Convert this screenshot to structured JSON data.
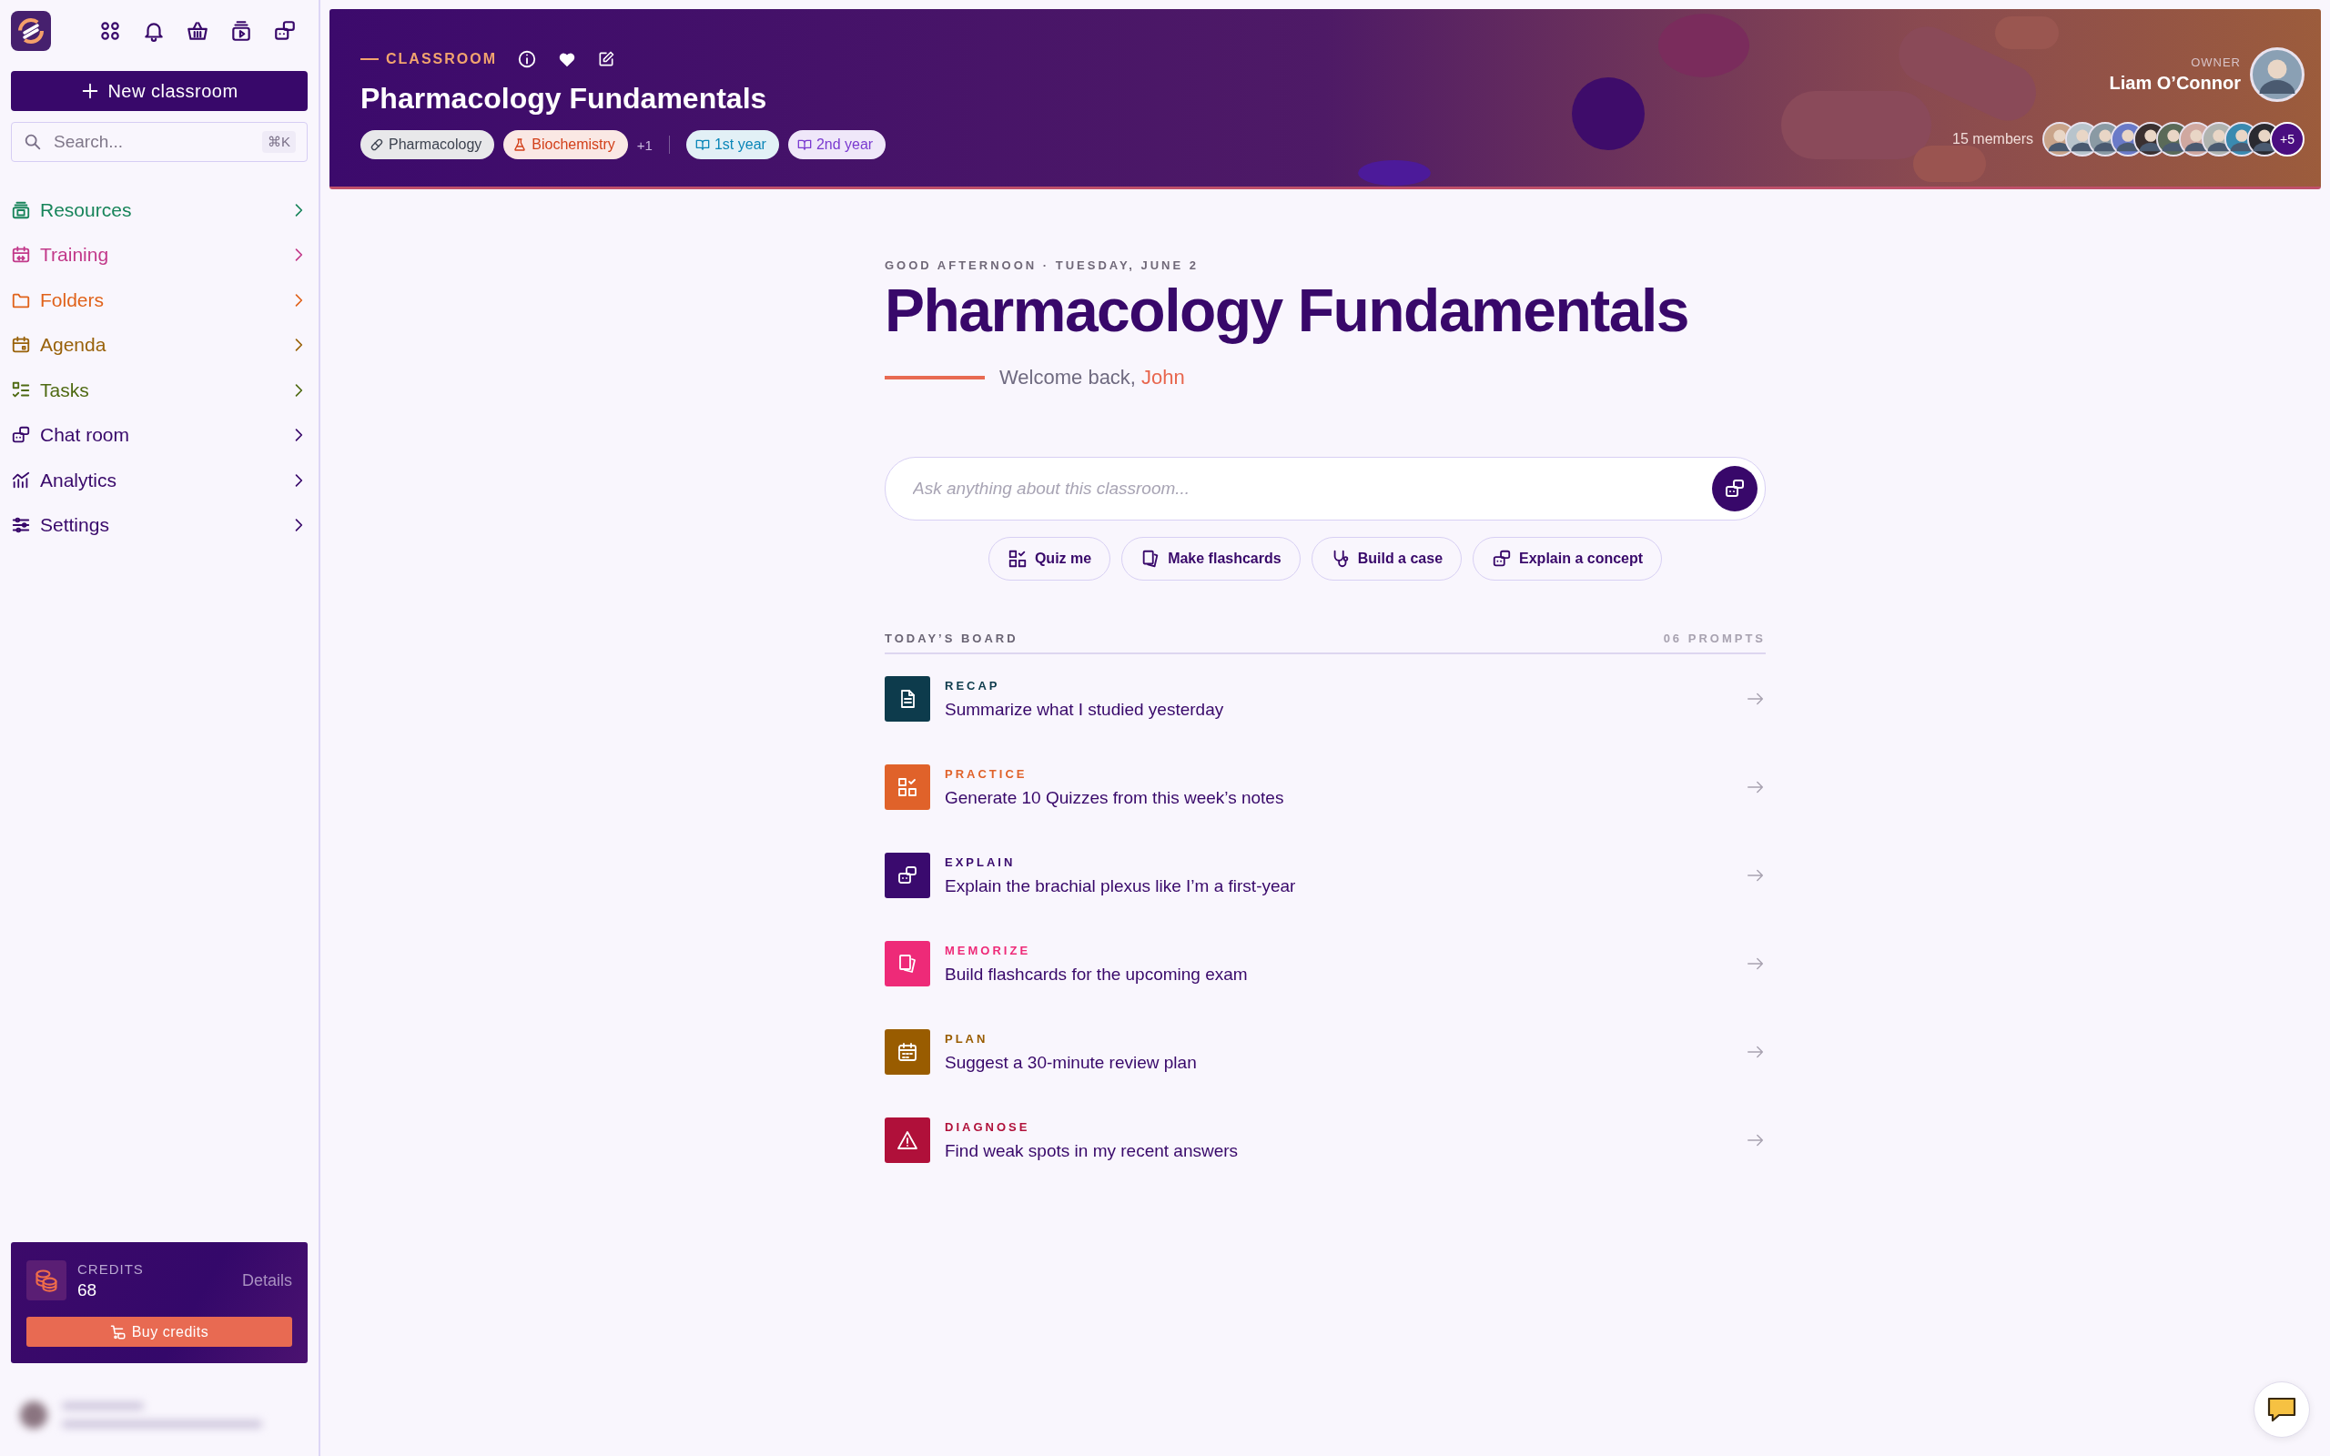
{
  "sidebar": {
    "new_button": "New classroom",
    "search": {
      "placeholder": "Search...",
      "shortcut": "⌘K"
    },
    "nav": [
      {
        "label": "Resources",
        "color": "#17845a"
      },
      {
        "label": "Training",
        "color": "#c2398a"
      },
      {
        "label": "Folders",
        "color": "#e0621a"
      },
      {
        "label": "Agenda",
        "color": "#99620a"
      },
      {
        "label": "Tasks",
        "color": "#4f6a12"
      },
      {
        "label": "Chat room",
        "color": "#38086a"
      },
      {
        "label": "Analytics",
        "color": "#38086a"
      },
      {
        "label": "Settings",
        "color": "#38086a"
      }
    ],
    "credits": {
      "label": "CREDITS",
      "value": "68",
      "details": "Details",
      "buy": "Buy credits"
    }
  },
  "banner": {
    "eyebrow": "CLASSROOM",
    "title": "Pharmacology Fundamentals",
    "tags": [
      {
        "label": "Pharmacology",
        "color": "#3d4350"
      },
      {
        "label": "Biochemistry",
        "color": "#d2401a"
      },
      {
        "label": "+1",
        "kind": "more"
      },
      {
        "label": "1st year",
        "color": "#0b86b8"
      },
      {
        "label": "2nd year",
        "color": "#7a3ad0"
      }
    ],
    "owner_label": "OWNER",
    "owner": "Liam O’Connor",
    "members": "15 members",
    "extra_members": "+5"
  },
  "hero": {
    "greeting": "GOOD AFTERNOON · TUESDAY, JUNE 2",
    "title": "Pharmacology Fundamentals",
    "welcome": "Welcome back,",
    "name": "John",
    "ask": {
      "placeholder": "Ask anything about this classroom..."
    },
    "chips": [
      "Quiz me",
      "Make flashcards",
      "Build a case",
      "Explain a concept"
    ]
  },
  "board": {
    "title": "TODAY’S BOARD",
    "count": "06 PROMPTS",
    "prompts": [
      {
        "category": "RECAP",
        "text": "Summarize what I studied yesterday",
        "color": "#0d3b4c"
      },
      {
        "category": "PRACTICE",
        "text": "Generate 10 Quizzes from this week’s notes",
        "color": "#e0622a"
      },
      {
        "category": "EXPLAIN",
        "text": "Explain the brachial plexus like I’m a first-year",
        "color": "#3a0a6e"
      },
      {
        "category": "MEMORIZE",
        "text": "Build flashcards for the upcoming exam",
        "color": "#ee2a78"
      },
      {
        "category": "PLAN",
        "text": "Suggest a 30-minute review plan",
        "color": "#995c00"
      },
      {
        "category": "DIAGNOSE",
        "text": "Find weak spots in my recent answers",
        "color": "#b0103a"
      }
    ]
  }
}
